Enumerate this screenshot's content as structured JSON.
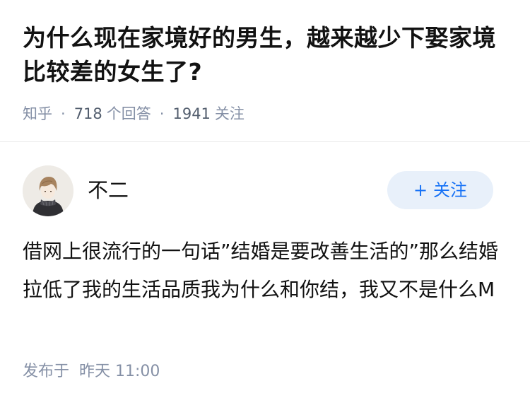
{
  "question": {
    "title": "为什么现在家境好的男生，越来越少下娶家境比较差的女生了?",
    "source": "知乎",
    "answer_count": "718",
    "answer_unit": "个回答",
    "follower_count": "1941",
    "follower_unit": "关注",
    "separator": "·"
  },
  "answer": {
    "author": {
      "name": "不二",
      "avatar_icon": "avatar-boy-illustration"
    },
    "follow_button": {
      "icon": "+",
      "label": "关注",
      "color": "#1772f6",
      "background": "#e8f0fa"
    },
    "content": "借网上很流行的一句话”结婚是要改善生活的”那么结婚拉低了我的生活品质我为什么和你结，我又不是什么M",
    "published_label": "发布于",
    "published_time": "昨天 11:00"
  }
}
